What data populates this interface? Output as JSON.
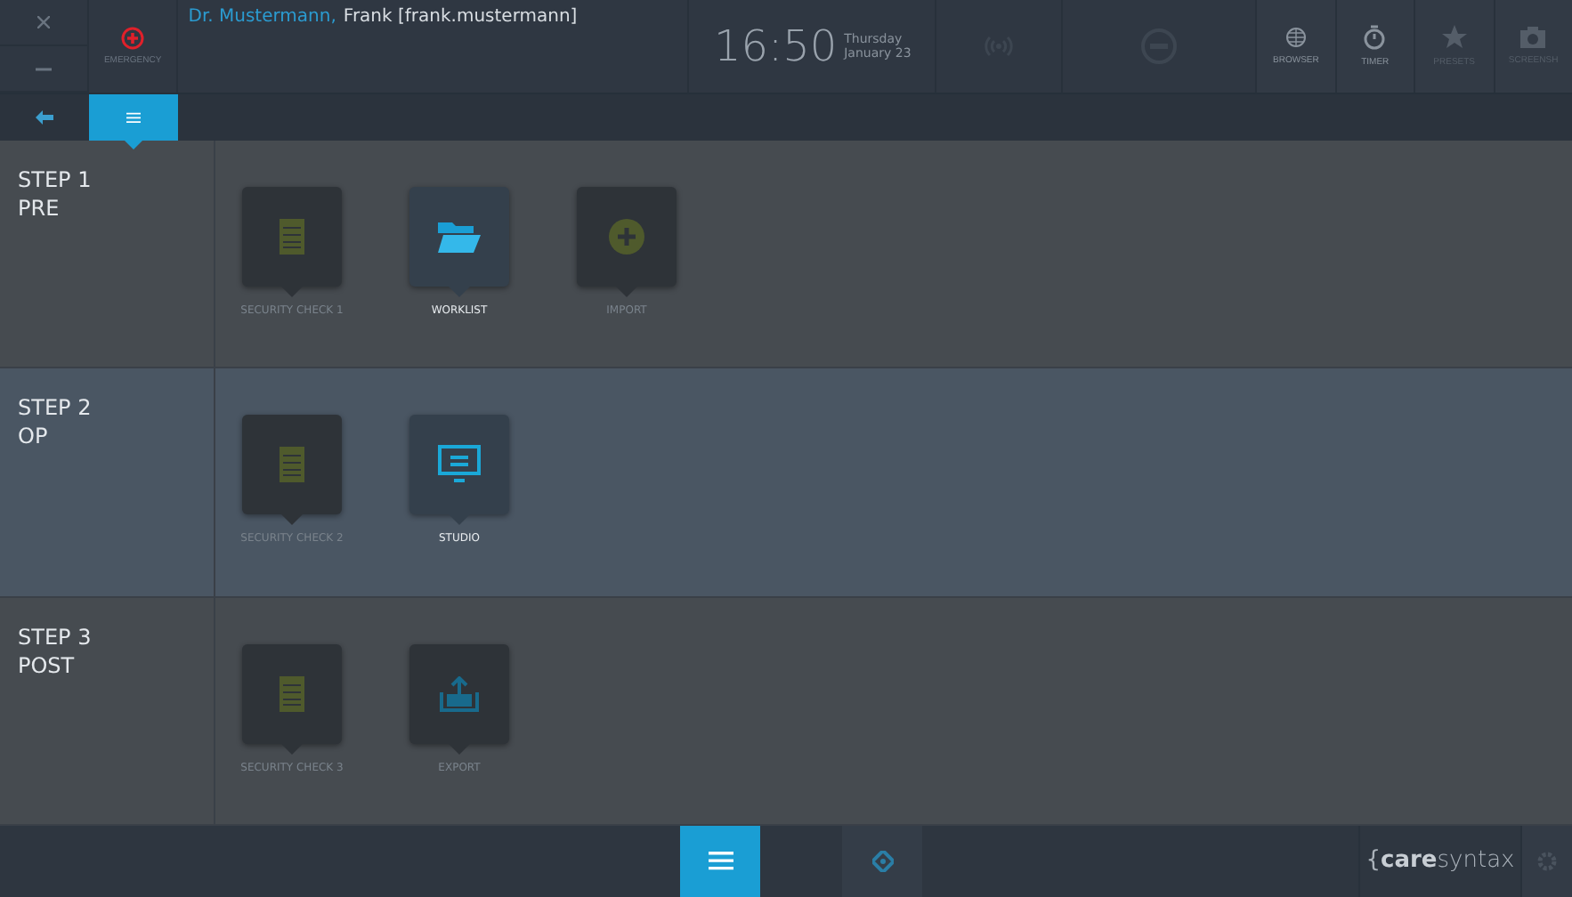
{
  "header": {
    "emergency": "EMERGENCY",
    "user_title": "Dr. Mustermann,",
    "user_name": "Frank [frank.mustermann]",
    "time": "16:50",
    "weekday": "Thursday",
    "date": "January 23",
    "tools": [
      {
        "kind": "globe",
        "label": "BROWSER",
        "disabled": false
      },
      {
        "kind": "timer",
        "label": "TIMER",
        "disabled": false
      },
      {
        "kind": "star",
        "label": "PRESETS",
        "disabled": true
      },
      {
        "kind": "camera",
        "label": "SCREENSH",
        "disabled": true
      }
    ]
  },
  "subnav": [
    {
      "kind": "back",
      "selected": false
    },
    {
      "kind": "menu",
      "selected": true
    }
  ],
  "steps": [
    {
      "title": "STEP 1",
      "phase": "PRE",
      "items": [
        {
          "kind": "checklist",
          "label": "SECURITY CHECK 1",
          "disabled": true
        },
        {
          "kind": "folder",
          "label": "WORKLIST",
          "disabled": false
        },
        {
          "kind": "plus",
          "label": "IMPORT",
          "disabled": true
        }
      ]
    },
    {
      "title": "STEP 2",
      "phase": "OP",
      "items": [
        {
          "kind": "checklist",
          "label": "SECURITY CHECK 2",
          "disabled": true
        },
        {
          "kind": "monitor",
          "label": "STUDIO",
          "disabled": false
        }
      ]
    },
    {
      "title": "STEP 3",
      "phase": "POST",
      "items": [
        {
          "kind": "checklist",
          "label": "SECURITY CHECK 3",
          "disabled": true
        },
        {
          "kind": "export",
          "label": "EXPORT",
          "disabled": true
        }
      ]
    }
  ],
  "footer": {
    "nav": [
      {
        "kind": "menu",
        "selected": true
      },
      {
        "kind": "target",
        "selected": false
      }
    ],
    "logo_brace": "{",
    "logo_care": "care",
    "logo_syntax": "syntax"
  }
}
